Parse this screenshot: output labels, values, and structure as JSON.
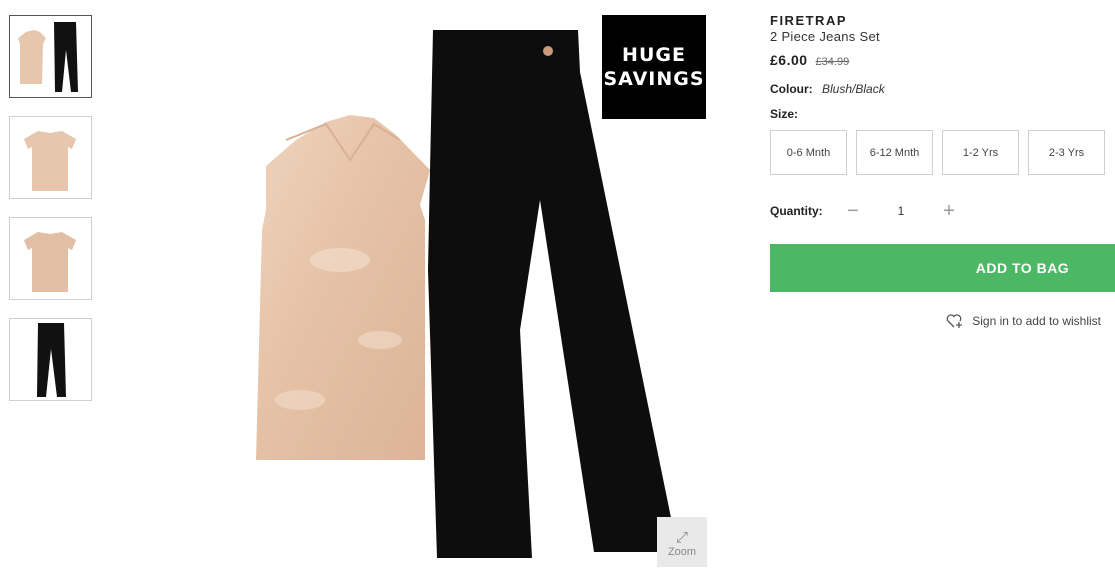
{
  "thumbnails": [
    {
      "alt": "set",
      "active": true
    },
    {
      "alt": "top front",
      "active": false
    },
    {
      "alt": "top back",
      "active": false
    },
    {
      "alt": "jeans",
      "active": false
    }
  ],
  "promo": {
    "line1": "HUGE",
    "line2": "SAVINGS"
  },
  "zoom": {
    "label": "Zoom",
    "icon": "expand-icon"
  },
  "product": {
    "brand": "FIRETRAP",
    "name": "2 Piece Jeans Set",
    "price": "£6.00",
    "was_price": "£34.99",
    "colour_label": "Colour:",
    "colour_value": "Blush/Black",
    "size_label": "Size:",
    "sizes": [
      "0-6 Mnth",
      "6-12 Mnth",
      "1-2 Yrs",
      "2-3 Yrs"
    ],
    "quantity_label": "Quantity:",
    "quantity_value": "1",
    "add_to_bag": "ADD TO BAG",
    "wishlist_text": "Sign in to add to wishlist"
  },
  "colors": {
    "accent_green": "#4cb866",
    "blush": "#e8c9b0",
    "denim_black": "#111111"
  }
}
